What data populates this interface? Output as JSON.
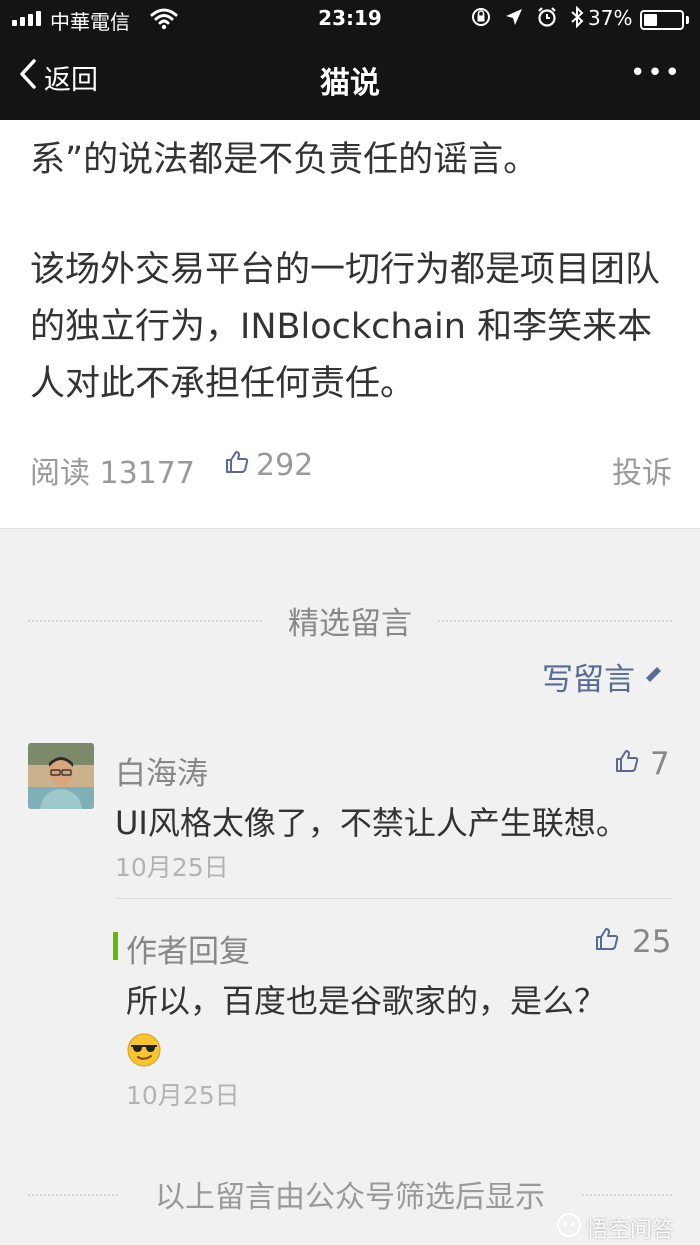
{
  "status_bar": {
    "carrier": "中華電信",
    "time": "23:19",
    "battery_percent": "37%",
    "battery_level": 0.37,
    "icons": [
      "signal-icon",
      "wifi-icon",
      "orientation-lock-icon",
      "location-icon",
      "alarm-icon",
      "bluetooth-icon",
      "battery-icon"
    ]
  },
  "nav": {
    "back_label": "返回",
    "title": "猫说",
    "more_label": "•••"
  },
  "article": {
    "paragraph1": "系”的说法都是不负责任的谣言。",
    "paragraph2": "该场外交易平台的一切行为都是项目团队的独立行为，INBlockchain 和李笑来本人对此不承担任何责任。",
    "read_label": "阅读 13177",
    "like_count": "292",
    "report_label": "投诉"
  },
  "comments_section": {
    "title": "精选留言",
    "write_label": "写留言",
    "comment": {
      "author": "白海涛",
      "likes": "7",
      "text": "UI风格太像了，不禁让人产生联想。",
      "date": "10月25日"
    },
    "reply": {
      "label": "作者回复",
      "likes": "25",
      "text": "所以，百度也是谷歌家的，是么？",
      "emoji": "sunglasses-emoji",
      "date": "10月25日"
    },
    "footer": "以上留言由公众号筛选后显示"
  },
  "watermark": "悟空问答",
  "colors": {
    "nav_bg": "#141414",
    "link": "#576b95",
    "reply_bar": "#62b900",
    "page_bg": "#f1f1f1"
  }
}
